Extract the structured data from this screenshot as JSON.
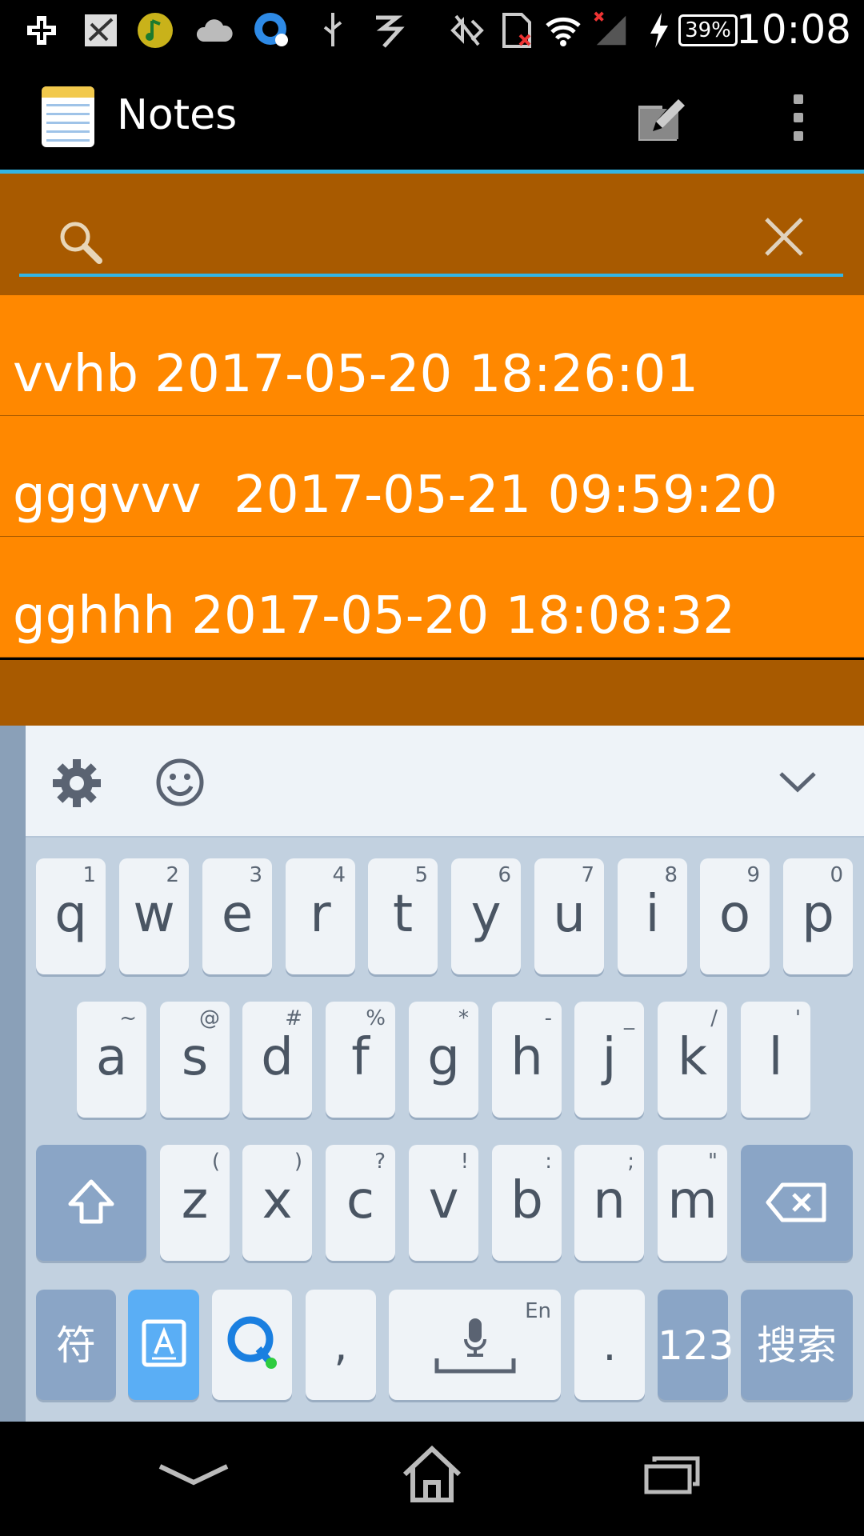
{
  "status_bar": {
    "time": "10:08",
    "battery": "39%",
    "icons": [
      "add-icon",
      "screenshot-icon",
      "music-icon",
      "cloud-icon",
      "browser-icon",
      "usb-icon",
      "input-method-icon",
      "nfc-off-icon",
      "sim-error-icon",
      "wifi-icon",
      "signal-icon",
      "charging-icon"
    ]
  },
  "action_bar": {
    "title": "Notes"
  },
  "search": {
    "value": ""
  },
  "notes": [
    "vvhb 2017-05-20 18:26:01",
    "gggvvv  2017-05-21 09:59:20",
    "gghhh 2017-05-20 18:08:32"
  ],
  "keyboard": {
    "row1": [
      {
        "k": "q",
        "s": "1"
      },
      {
        "k": "w",
        "s": "2"
      },
      {
        "k": "e",
        "s": "3"
      },
      {
        "k": "r",
        "s": "4"
      },
      {
        "k": "t",
        "s": "5"
      },
      {
        "k": "y",
        "s": "6"
      },
      {
        "k": "u",
        "s": "7"
      },
      {
        "k": "i",
        "s": "8"
      },
      {
        "k": "o",
        "s": "9"
      },
      {
        "k": "p",
        "s": "0"
      }
    ],
    "row2": [
      {
        "k": "a",
        "s": "~"
      },
      {
        "k": "s",
        "s": "@"
      },
      {
        "k": "d",
        "s": "#"
      },
      {
        "k": "f",
        "s": "%"
      },
      {
        "k": "g",
        "s": "*"
      },
      {
        "k": "h",
        "s": "-"
      },
      {
        "k": "j",
        "s": "_"
      },
      {
        "k": "k",
        "s": "/"
      },
      {
        "k": "l",
        "s": "'"
      }
    ],
    "row3": [
      {
        "k": "z",
        "s": "("
      },
      {
        "k": "x",
        "s": ")"
      },
      {
        "k": "c",
        "s": "?"
      },
      {
        "k": "v",
        "s": "!"
      },
      {
        "k": "b",
        "s": ":"
      },
      {
        "k": "n",
        "s": ";"
      },
      {
        "k": "m",
        "s": "\""
      }
    ],
    "symbol_key": "符",
    "comma_key": ",",
    "space_hint": "En",
    "period_key": ".",
    "numbers_key": "123",
    "search_key": "搜索"
  }
}
